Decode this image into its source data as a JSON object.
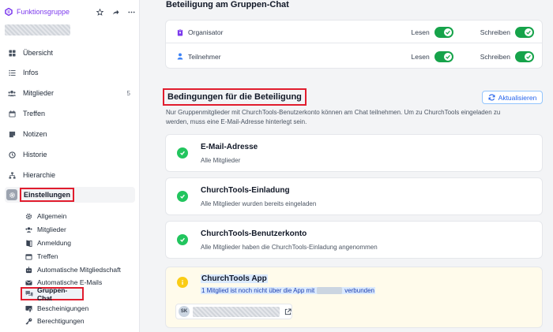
{
  "sidebar": {
    "group_type": "Funktionsgruppe",
    "nav": [
      {
        "label": "Übersicht",
        "icon": "grid-icon",
        "count": ""
      },
      {
        "label": "Infos",
        "icon": "list-icon",
        "count": ""
      },
      {
        "label": "Mitglieder",
        "icon": "users-icon",
        "count": "5"
      },
      {
        "label": "Treffen",
        "icon": "calendar-icon",
        "count": ""
      },
      {
        "label": "Notizen",
        "icon": "note-icon",
        "count": ""
      },
      {
        "label": "Historie",
        "icon": "history-icon",
        "count": ""
      },
      {
        "label": "Hierarchie",
        "icon": "hierarchy-icon",
        "count": ""
      }
    ],
    "settings_label": "Einstellungen",
    "sub": [
      {
        "label": "Allgemein",
        "icon": "gear-icon"
      },
      {
        "label": "Mitglieder",
        "icon": "users-icon"
      },
      {
        "label": "Anmeldung",
        "icon": "door-icon"
      },
      {
        "label": "Treffen",
        "icon": "calendar-icon"
      },
      {
        "label": "Automatische Mitgliedschaft",
        "icon": "robot-icon"
      },
      {
        "label": "Automatische E-Mails",
        "icon": "envelope-icon"
      },
      {
        "label": "Gruppen-Chat",
        "icon": "chat-icon"
      },
      {
        "label": "Bescheinigungen",
        "icon": "certificate-icon"
      },
      {
        "label": "Berechtigungen",
        "icon": "key-icon"
      }
    ]
  },
  "main": {
    "chat_section_title": "Beteiligung am Gruppen-Chat",
    "roles": [
      {
        "name": "Organisator",
        "read": "Lesen",
        "write": "Schreiben"
      },
      {
        "name": "Teilnehmer",
        "read": "Lesen",
        "write": "Schreiben"
      }
    ],
    "conditions_title": "Bedingungen für die Beteiligung",
    "refresh_label": "Aktualisieren",
    "description": "Nur Gruppenmitglieder mit ChurchTools-Benutzerkonto können am Chat teilnehmen. Um zu ChurchTools eingeladen zu werden, muss eine E-Mail-Adresse hinterlegt sein.",
    "conditions": [
      {
        "title": "E-Mail-Adresse",
        "subtitle": "Alle Mitglieder"
      },
      {
        "title": "ChurchTools-Einladung",
        "subtitle": "Alle Mitglieder wurden bereits eingeladen"
      },
      {
        "title": "ChurchTools-Benutzerkonto",
        "subtitle": "Alle Mitglieder haben die ChurchTools-Einladung angenommen"
      }
    ],
    "app_condition": {
      "title": "ChurchTools App",
      "subtitle_prefix": "1 Mitglied ist noch nicht über die App mit",
      "subtitle_suffix": "verbunden",
      "member_initials": "SK"
    }
  },
  "colors": {
    "accent": "#7c3aed",
    "toggle_on": "#16a34a",
    "ok": "#22c55e",
    "warn": "#facc15",
    "highlight": "#e11d2e",
    "link": "#2563eb"
  }
}
